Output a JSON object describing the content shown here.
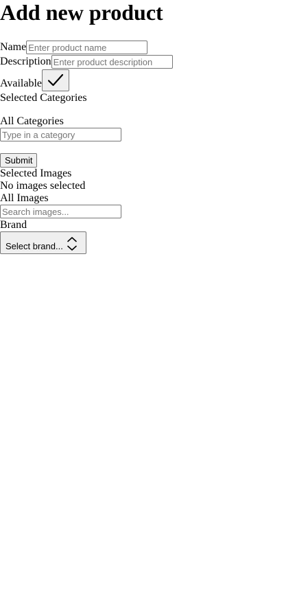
{
  "page": {
    "title": "Add new product"
  },
  "form": {
    "name_label": "Name",
    "name_placeholder": "Enter product name",
    "description_label": "Description",
    "description_placeholder": "Enter product description",
    "available_label": "Available",
    "available_checked": true,
    "selected_categories_label": "Selected Categories",
    "all_categories_label": "All Categories",
    "category_placeholder": "Type in a category",
    "submit_label": "Submit",
    "selected_images_label": "Selected Images",
    "no_images_text": "No images selected",
    "all_images_label": "All Images",
    "images_search_placeholder": "Search images...",
    "brand_label": "Brand",
    "brand_select_label": "Select brand..."
  },
  "icons": {
    "available_toggle": "check-icon",
    "brand_select": "chevrons-up-down-icon"
  }
}
